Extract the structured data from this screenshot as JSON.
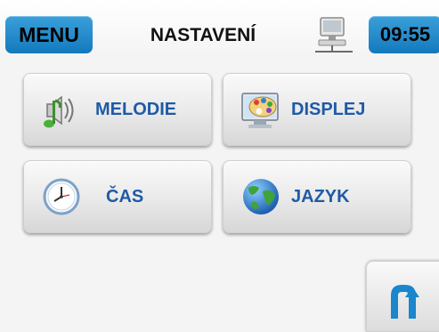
{
  "header": {
    "menu_label": "MENU",
    "title": "NASTAVENÍ",
    "time": "09:55",
    "network_icon": "network-computer-icon"
  },
  "tiles": [
    {
      "label": "MELODIE",
      "icon": "melody-speaker-icon"
    },
    {
      "label": "DISPLEJ",
      "icon": "display-palette-icon"
    },
    {
      "label": "ČAS",
      "icon": "clock-icon"
    },
    {
      "label": "JAZYK",
      "icon": "globe-icon"
    }
  ],
  "footer": {
    "back_icon": "back-arrow-icon"
  },
  "colors": {
    "accent": "#1a86cc",
    "label": "#1f5aa6"
  }
}
